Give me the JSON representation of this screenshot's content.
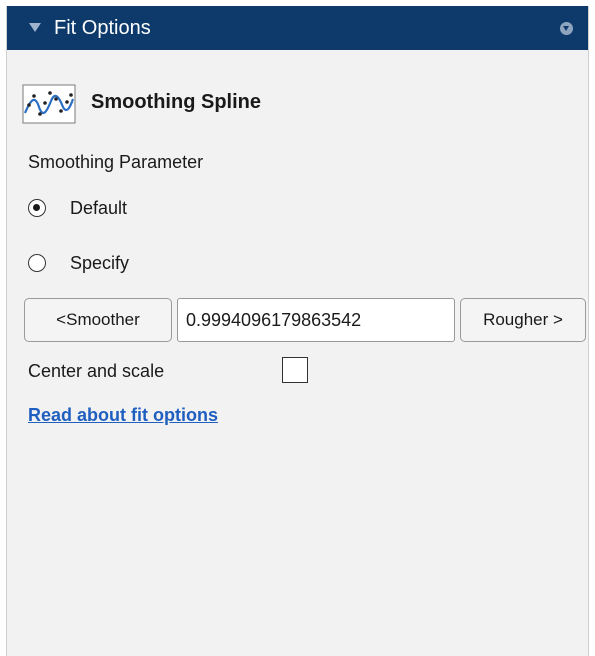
{
  "header": {
    "title": "Fit Options",
    "collapse_icon": "triangle-down-icon",
    "menu_icon": "circle-chevron-down-icon",
    "background_color": "#0d3a6b"
  },
  "fit": {
    "name": "Smoothing Spline",
    "icon": "smoothing-spline-icon"
  },
  "smoothing": {
    "section_label": "Smoothing Parameter",
    "options": [
      {
        "label": "Default",
        "selected": true
      },
      {
        "label": "Specify",
        "selected": false
      }
    ],
    "smoother_label": "<Smoother",
    "rougher_label": "Rougher >",
    "value": "0.9994096179863542"
  },
  "center_scale": {
    "label": "Center and scale",
    "checked": false
  },
  "help_link": {
    "label": "Read about fit options",
    "color": "#1f5fbf"
  }
}
